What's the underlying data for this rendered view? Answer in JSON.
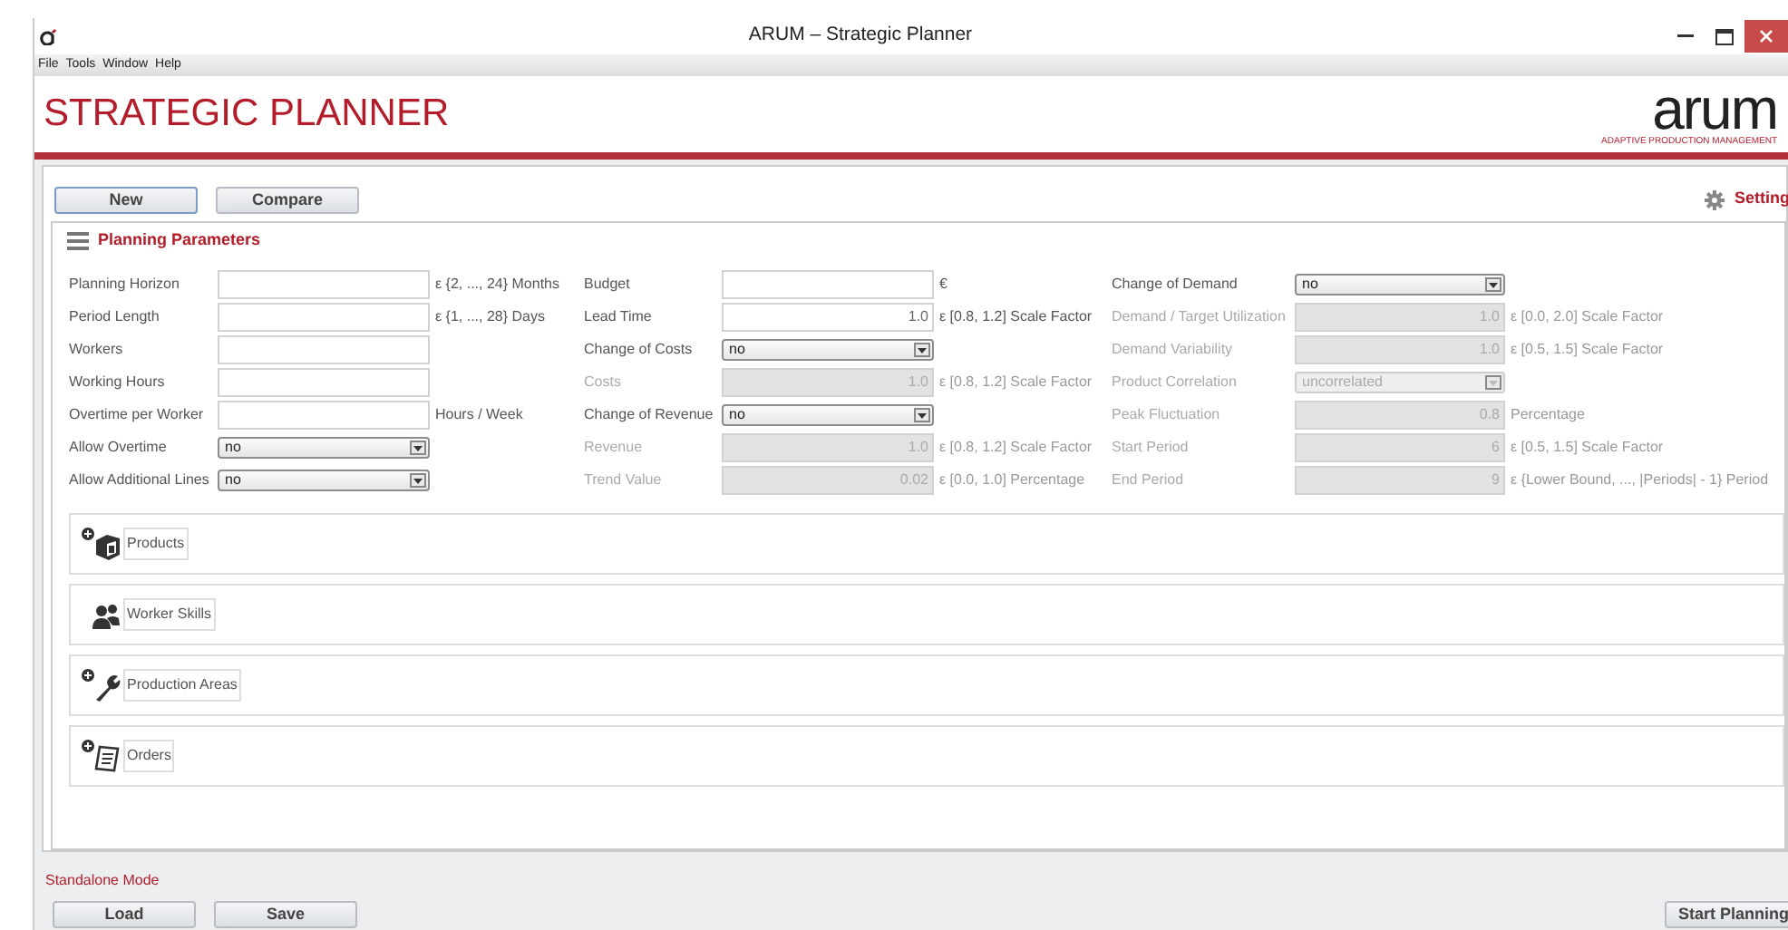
{
  "window": {
    "title": "ARUM – Strategic Planner"
  },
  "menu": [
    "File",
    "Tools",
    "Window",
    "Help"
  ],
  "header": {
    "title": "STRATEGIC PLANNER",
    "logo": "arum",
    "logo_tagline": "ADAPTIVE PRODUCTION MANAGEMENT"
  },
  "toolbar": {
    "buttons": [
      {
        "label": "New",
        "focused": true
      },
      {
        "label": "Compare",
        "focused": false
      }
    ],
    "settings": "Setting"
  },
  "parameters": {
    "title": "Planning Parameters",
    "columns": [
      [
        {
          "label": "Planning Horizon",
          "kind": "text",
          "unit": "ε {2, ..., 24} Months",
          "disabled": false
        },
        {
          "label": "Period Length",
          "kind": "text",
          "unit": "ε {1, ..., 28} Days",
          "disabled": false
        },
        {
          "label": "Workers",
          "kind": "text",
          "disabled": false
        },
        {
          "label": "Working Hours",
          "kind": "text",
          "disabled": false
        },
        {
          "label": "Overtime per Worker",
          "kind": "text",
          "unit": "Hours / Week",
          "disabled": false
        },
        {
          "label": "Allow Overtime",
          "kind": "select",
          "value": "no",
          "disabled": false
        },
        {
          "label": "Allow Additional Lines",
          "kind": "select",
          "value": "no",
          "disabled": false
        }
      ],
      [
        {
          "label": "Budget",
          "kind": "text",
          "unit": "€",
          "disabled": false
        },
        {
          "label": "Lead Time",
          "kind": "text",
          "value": "1.0",
          "unit": "ε [0.8, 1.2] Scale Factor",
          "disabled": false
        },
        {
          "label": "Change of Costs",
          "kind": "select",
          "value": "no",
          "disabled": false
        },
        {
          "label": "Costs",
          "kind": "text",
          "value": "1.0",
          "unit": "ε [0.8, 1.2] Scale Factor",
          "disabled": true
        },
        {
          "label": "Change of Revenue",
          "kind": "select",
          "value": "no",
          "disabled": false
        },
        {
          "label": "Revenue",
          "kind": "text",
          "value": "1.0",
          "unit": "ε [0.8, 1.2] Scale Factor",
          "disabled": true
        },
        {
          "label": "Trend Value",
          "kind": "text",
          "value": "0.02",
          "unit": "ε [0.0, 1.0] Percentage",
          "disabled": true
        }
      ],
      [
        {
          "label": "Change of Demand",
          "kind": "select",
          "value": "no",
          "disabled": false
        },
        {
          "label": "Demand / Target Utilization",
          "kind": "text",
          "value": "1.0",
          "unit": "ε [0.0, 2.0] Scale Factor",
          "disabled": true
        },
        {
          "label": "Demand Variability",
          "kind": "text",
          "value": "1.0",
          "unit": "ε [0.5, 1.5] Scale Factor",
          "disabled": true
        },
        {
          "label": "Product Correlation",
          "kind": "select",
          "value": "uncorrelated",
          "disabled": true
        },
        {
          "label": "Peak Fluctuation",
          "kind": "text",
          "value": "0.8",
          "unit": "Percentage",
          "disabled": true
        },
        {
          "label": "Start Period",
          "kind": "text",
          "value": "6",
          "unit": "ε [0.5, 1.5] Scale Factor",
          "disabled": true
        },
        {
          "label": "End Period",
          "kind": "text",
          "value": "9",
          "unit": "ε {Lower Bound, ..., |Periods| - 1} Period",
          "disabled": true
        }
      ]
    ]
  },
  "sections": [
    {
      "label": "Products",
      "kind": "box",
      "expandable": true
    },
    {
      "label": "Worker Skills",
      "kind": "people",
      "expandable": false
    },
    {
      "label": "Production Areas",
      "kind": "wrench",
      "expandable": true
    },
    {
      "label": "Orders",
      "kind": "document",
      "expandable": true
    }
  ],
  "footer": {
    "mode": "Standalone Mode",
    "buttons": [
      "Load",
      "Save"
    ],
    "start": "Start Planning"
  }
}
